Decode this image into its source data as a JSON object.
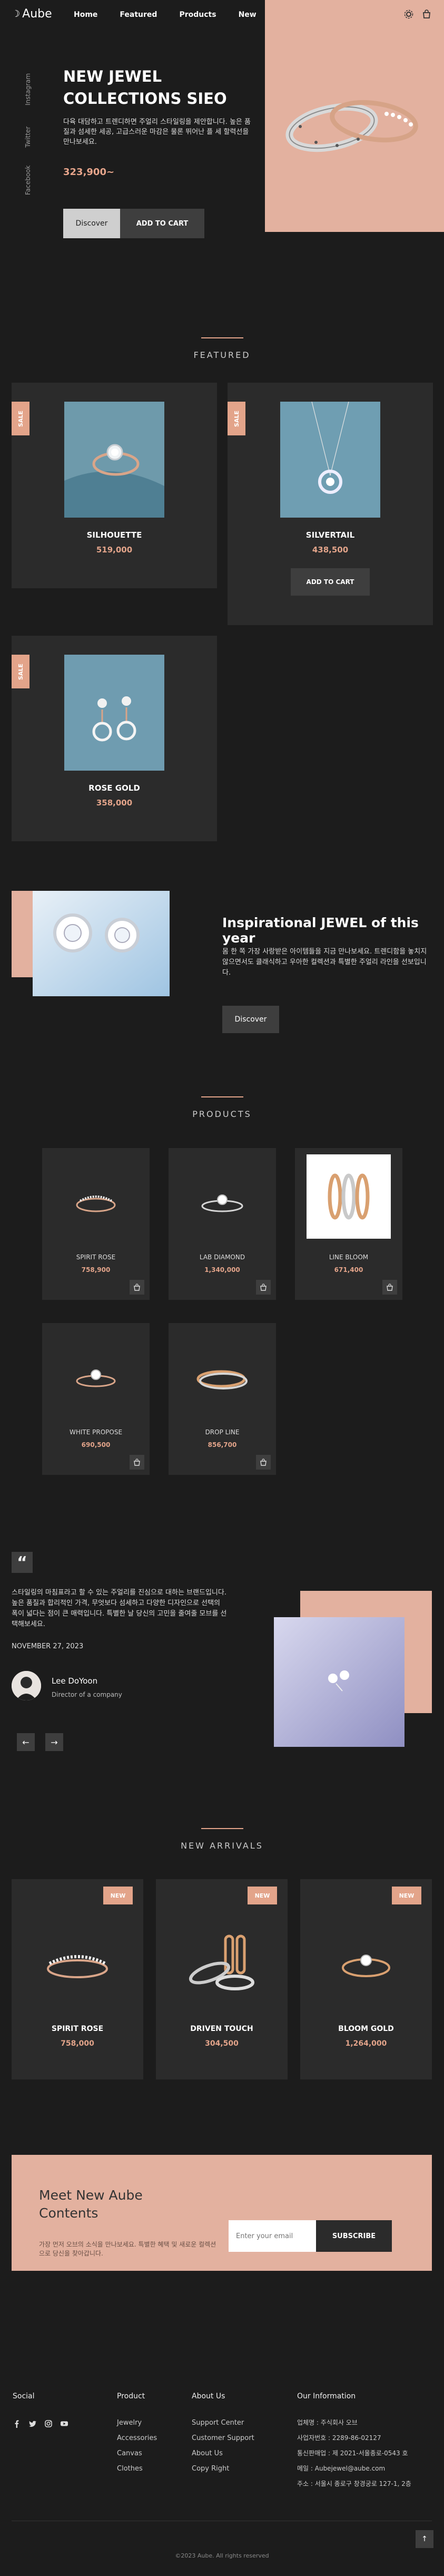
{
  "header": {
    "logo_text": "Aube",
    "nav": [
      "Home",
      "Featured",
      "Products",
      "New"
    ],
    "icons": [
      "settings-icon",
      "cart-icon"
    ]
  },
  "hero": {
    "social": [
      "Instagram",
      "Twitter",
      "Facebook"
    ],
    "title": "NEW JEWEL COLLECTIONS SIEO",
    "description": "다육 대담하고 트렌디하면 주얼리 스타일링을 제안합니다. 높은 품질과 섬세한 세공, 고급스러운 마감은 물론 뛰어난 플 세 할력선을 만나보세요.",
    "price": "323,900~",
    "discover_label": "Discover",
    "cart_label": "ADD TO CART"
  },
  "featured": {
    "heading": "FEATURED",
    "items": [
      {
        "badge": "SALE",
        "name": "SILHOUETTE",
        "price": "519,000"
      },
      {
        "badge": "SALE",
        "name": "SILVERTAIL",
        "price": "438,500",
        "cart_label": "ADD TO CART"
      },
      {
        "badge": "SALE",
        "name": "ROSE GOLD",
        "price": "358,000"
      }
    ]
  },
  "inspirational": {
    "title": "Inspirational JEWEL of this year",
    "description": "몸 한 쪽 가장 사랑받은 아이템들을 지금 만나보세요. 트렌디함을 놓치지 않으면서도 클래식하고 우아한 컬렉션과 특별한 주얼리 라인을 선보입니다.",
    "button_label": "Discover"
  },
  "products": {
    "heading": "PRODUCTS",
    "items": [
      {
        "name": "SPIRIT ROSE",
        "price": "758,900"
      },
      {
        "name": "LAB DIAMOND",
        "price": "1,340,000"
      },
      {
        "name": "LINE BLOOM",
        "price": "671,400"
      },
      {
        "name": "WHITE PROPOSE",
        "price": "690,500"
      },
      {
        "name": "DROP LINE",
        "price": "856,700"
      }
    ]
  },
  "testimonial": {
    "quote_mark": "“",
    "text": "스타일링의 마침표라고 할 수 있는 주얼리를 진심으로 대하는 브랜드입니다. 높은 품질과 합리적인 가격, 무엇보다 섬세하고 다양한 디자인으로 선택의 폭이 넓다는 점이 큰 매력입니다. 특별한 날 당신의 고민을 줄여줄 모브를 선택해보세요.",
    "date": "NOVEMBER 27, 2023",
    "name": "Lee DoYoon",
    "role": "Director of a company",
    "prev": "←",
    "next": "→"
  },
  "new_arrivals": {
    "heading": "NEW ARRIVALS",
    "items": [
      {
        "badge": "NEW",
        "name": "SPIRIT ROSE",
        "price": "758,000"
      },
      {
        "badge": "NEW",
        "name": "DRIVEN TOUCH",
        "price": "304,500"
      },
      {
        "badge": "NEW",
        "name": "BLOOM GOLD",
        "price": "1,264,000"
      }
    ]
  },
  "newsletter": {
    "title": "Meet New Aube Contents",
    "description": "가장 먼저 오브의 소식을 만나보세요. 특별한 혜택 및 새로운 컬렉션으로 당신을 찾아갑니다.",
    "placeholder": "Enter your email",
    "button_label": "SUBSCRIBE"
  },
  "footer": {
    "social_heading": "Social",
    "social_icons": [
      "facebook-icon",
      "twitter-icon",
      "instagram-icon",
      "youtube-icon"
    ],
    "product_heading": "Product",
    "product_links": [
      "Jewelry",
      "Accessories",
      "Canvas",
      "Clothes"
    ],
    "about_heading": "About Us",
    "about_links": [
      "Support Center",
      "Customer Support",
      "About Us",
      "Copy Right"
    ],
    "info_heading": "Our Information",
    "info_lines": [
      "업체명 : 주식회사 오브",
      "사업자번호 : 2289-86-02127",
      "통신판매업 : 제 2021-서울종로-0543 호",
      "메일 : Aubejewel@aube.com",
      "주소 : 서울시 종로구 창경궁로 127-1, 2층"
    ],
    "copyright": "©2023 Aube. All rights reserved",
    "to_top": "↑"
  }
}
